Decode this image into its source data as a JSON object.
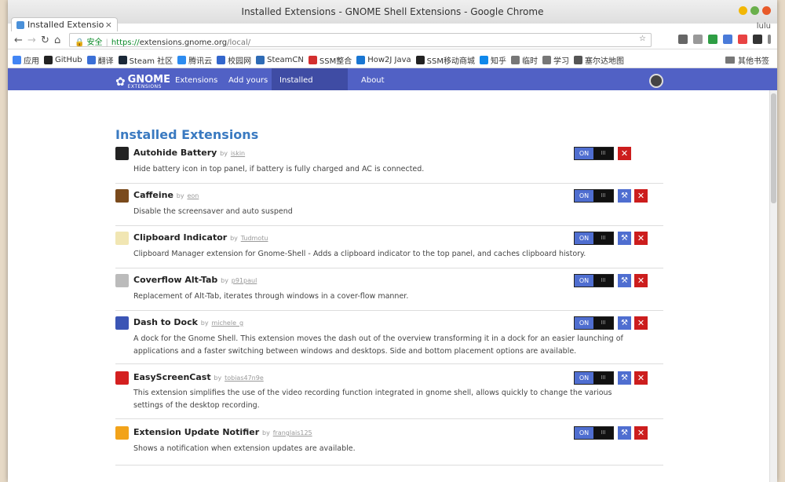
{
  "window": {
    "title": "Installed Extensions - GNOME Shell Extensions - Google Chrome",
    "user_label": "lulu"
  },
  "tab": {
    "title": "Installed Extensio",
    "close": "×"
  },
  "omnibox": {
    "secure_label": "安全",
    "url_protocol": "https://",
    "url_host": "extensions.gnome.org",
    "url_path": "/local/"
  },
  "bookmarks": {
    "items": [
      {
        "label": "应用",
        "color": "#4285f4"
      },
      {
        "label": "GitHub",
        "color": "#222222"
      },
      {
        "label": "翻译",
        "color": "#3b6fd6"
      },
      {
        "label": "Steam 社区",
        "color": "#1b2838"
      },
      {
        "label": "腾讯云",
        "color": "#2d8cf0"
      },
      {
        "label": "校园网",
        "color": "#3366cc"
      },
      {
        "label": "SteamCN",
        "color": "#2e6bb5"
      },
      {
        "label": "SSM整合",
        "color": "#d32f2f"
      },
      {
        "label": "How2J Java",
        "color": "#1976d2"
      },
      {
        "label": "SSM移动商城",
        "color": "#222222"
      },
      {
        "label": "知乎",
        "color": "#0f88eb"
      },
      {
        "label": "临时",
        "color": "#777777"
      },
      {
        "label": "学习",
        "color": "#777777"
      },
      {
        "label": "塞尔达地图",
        "color": "#555555"
      }
    ],
    "other": "其他书签"
  },
  "gnome_nav": {
    "logo": "GNOME",
    "logo_sub": "EXTENSIONS",
    "items": [
      "Extensions",
      "Add yours",
      "Installed extensions",
      "About"
    ]
  },
  "page": {
    "heading": "Installed Extensions",
    "by_label": "by"
  },
  "toggle": {
    "on_label": "ON",
    "off_label": "III"
  },
  "extensions": [
    {
      "name": "Autohide Battery",
      "author": "iskin",
      "desc": "Hide battery icon in top panel, if battery is fully charged and AC is connected.",
      "icon_color": "#222222",
      "prefs": false
    },
    {
      "name": "Caffeine",
      "author": "eon",
      "desc": "Disable the screensaver and auto suspend",
      "icon_color": "#7a4a1c",
      "prefs": true
    },
    {
      "name": "Clipboard Indicator",
      "author": "Tudmotu",
      "desc": "Clipboard Manager extension for Gnome-Shell - Adds a clipboard indicator to the top panel, and caches clipboard history.",
      "icon_color": "#f1e6b3",
      "prefs": true
    },
    {
      "name": "Coverflow Alt-Tab",
      "author": "p91paul",
      "desc": "Replacement of Alt-Tab, iterates through windows in a cover-flow manner.",
      "icon_color": "#bbbbbb",
      "prefs": true
    },
    {
      "name": "Dash to Dock",
      "author": "michele_g",
      "desc": "A dock for the Gnome Shell. This extension moves the dash out of the overview transforming it in a dock for an easier launching of applications and a faster switching between windows and desktops. Side and bottom placement options are available.",
      "icon_color": "#3b55b5",
      "prefs": true
    },
    {
      "name": "EasyScreenCast",
      "author": "tobias47n9e",
      "desc": "This extension simplifies the use of the video recording function integrated in gnome shell, allows quickly to change the various settings of the desktop recording.",
      "icon_color": "#d42020",
      "prefs": true
    },
    {
      "name": "Extension Update Notifier",
      "author": "franglais125",
      "desc": "Shows a notification when extension updates are available.",
      "icon_color": "#f2a31a",
      "prefs": true
    }
  ]
}
